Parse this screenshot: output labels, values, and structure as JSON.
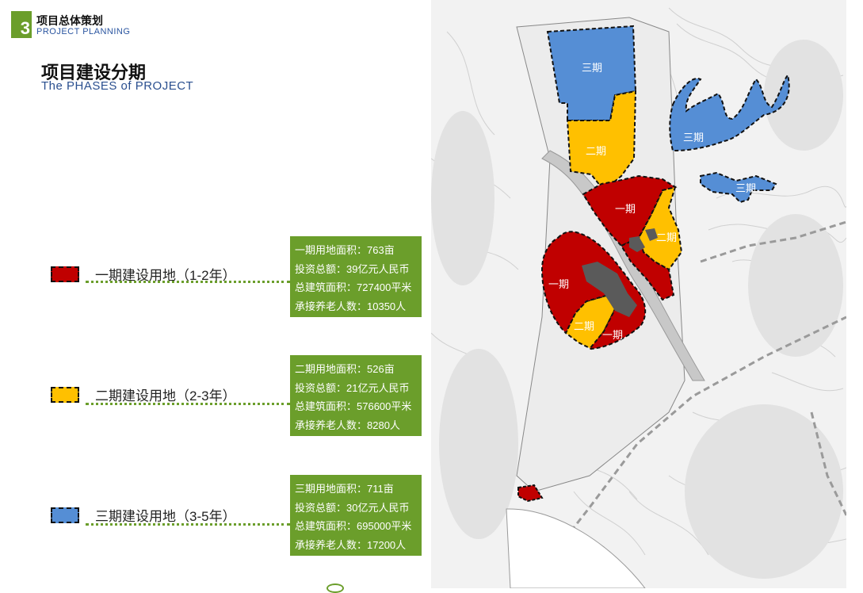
{
  "header": {
    "section_number": "3",
    "section_title": "项目总体策划",
    "section_subtitle": "PROJECT  PLANNING"
  },
  "page": {
    "title": "项目建设分期",
    "subtitle": "The  PHASES of  PROJECT"
  },
  "colors": {
    "phase1": "#c00000",
    "phase2": "#ffc000",
    "phase3": "#558ed5",
    "accent_green": "#6b9e2b"
  },
  "phases": [
    {
      "legend": "一期建设用地（1-2年）",
      "color": "#c00000",
      "info": [
        "一期用地面积：763亩",
        "投资总额：39亿元人民币",
        "总建筑面积：727400平米",
        "承接养老人数：10350人"
      ]
    },
    {
      "legend": "二期建设用地（2-3年）",
      "color": "#ffc000",
      "info": [
        "二期用地面积：526亩",
        "投资总额：21亿元人民币",
        "总建筑面积：576600平米",
        "承接养老人数：8280人"
      ]
    },
    {
      "legend": "三期建设用地（3-5年）",
      "color": "#558ed5",
      "info": [
        "三期用地面积：711亩",
        "投资总额：30亿元人民币",
        "总建筑面积：695000平米",
        "承接养老人数：17200人"
      ]
    }
  ],
  "map": {
    "zone_labels": {
      "phase3_a": "三期",
      "phase3_b": "三期",
      "phase3_c": "三期",
      "phase2_a": "二期",
      "phase2_b": "二期",
      "phase2_c": "二期",
      "phase1_a": "一期",
      "phase1_b": "一期",
      "phase1_c": "一期"
    }
  }
}
